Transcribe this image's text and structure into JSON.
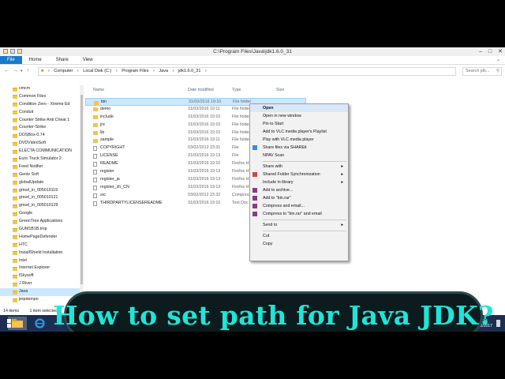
{
  "window": {
    "title": "C:\\Program Files\\Java\\jdk1.6.0_31",
    "controls": [
      "–",
      "□",
      "✕"
    ]
  },
  "ribbon": {
    "tabs": [
      "File",
      "Home",
      "Share",
      "View"
    ]
  },
  "nav": {
    "back": "←",
    "forward": "→",
    "up": "↑",
    "path": [
      "Computer",
      "Local Disk (C:)",
      "Program Files",
      "Java",
      "jdk1.6.0_31"
    ],
    "search_placeholder": "Search jdk..."
  },
  "sidebar": {
    "items": [
      "cmcm",
      "Common Files",
      "Condition Zero - Xtreme Ed",
      "Conduit",
      "Counter Strike Anti Cheat 1",
      "Counter-Strike",
      "DOSBox-0.74",
      "DVDVideoSoft",
      "ELECTA COMMUNICATION",
      "Euro Truck Simulator 2",
      "Feed Notifier",
      "Genie Soft",
      "globalUpdate",
      "gmsd_in_005010119",
      "gmsd_in_005010121",
      "gmsd_in_005010129",
      "Google",
      "GreenTree Applications",
      "GUM1B1B.tmp",
      "HomePageDefender",
      "HTC",
      "InstallShield Installation",
      "Intel",
      "Internet Explorer",
      "iSkysoft",
      "J River",
      "Java",
      "jeqotempo"
    ],
    "selected_index": 26
  },
  "columns": {
    "name": "Name",
    "date": "Date modified",
    "type": "Type",
    "size": "Size"
  },
  "files": [
    {
      "name": "bin",
      "date": "31/03/2016 19:10",
      "type": "File folder",
      "kind": "folder"
    },
    {
      "name": "demo",
      "date": "31/03/2016 19:11",
      "type": "File folder",
      "kind": "folder"
    },
    {
      "name": "include",
      "date": "31/03/2016 19:10",
      "type": "File folder",
      "kind": "folder"
    },
    {
      "name": "jre",
      "date": "31/03/2016 19:10",
      "type": "File folder",
      "kind": "folder"
    },
    {
      "name": "lib",
      "date": "31/03/2016 19:10",
      "type": "File folder",
      "kind": "folder"
    },
    {
      "name": "sample",
      "date": "31/03/2016 19:11",
      "type": "File folder",
      "kind": "folder"
    },
    {
      "name": "COPYRIGHT",
      "date": "03/02/2012 23:31",
      "type": "File",
      "kind": "doc"
    },
    {
      "name": "LICENSE",
      "date": "31/03/2016 19:13",
      "type": "File",
      "kind": "doc"
    },
    {
      "name": "README",
      "date": "31/03/2016 19:10",
      "type": "Firefox HTML",
      "kind": "doc"
    },
    {
      "name": "register",
      "date": "31/03/2016 19:13",
      "type": "Firefox HTML",
      "kind": "doc"
    },
    {
      "name": "register_ja",
      "date": "31/03/2016 19:13",
      "type": "Firefox HTML",
      "kind": "doc"
    },
    {
      "name": "register_zh_CN",
      "date": "31/03/2016 19:13",
      "type": "Firefox HTML",
      "kind": "doc"
    },
    {
      "name": "src",
      "date": "03/02/2012 23:32",
      "type": "Compressed",
      "kind": "doc"
    },
    {
      "name": "THIRDPARTYLICENSEREADME",
      "date": "31/03/2016 19:10",
      "type": "Text Doc",
      "kind": "doc"
    }
  ],
  "context_menu": [
    {
      "label": "Open",
      "bold": true
    },
    {
      "label": "Open in new window"
    },
    {
      "label": "Pin to Start"
    },
    {
      "label": "Add to VLC media player's Playlist"
    },
    {
      "label": "Play with VLC media player"
    },
    {
      "label": "Share files via SHAREit",
      "icon": "shareit-icon"
    },
    {
      "label": "NPAV Scan"
    },
    {
      "sep": true
    },
    {
      "label": "Share with",
      "sub": true
    },
    {
      "label": "Shared Folder Synchronization",
      "sub": true,
      "icon": "sync-icon"
    },
    {
      "label": "Include in library",
      "sub": true
    },
    {
      "label": "Add to archive...",
      "icon": "winrar-icon"
    },
    {
      "label": "Add to \"bin.rar\"",
      "icon": "winrar-icon"
    },
    {
      "label": "Compress and email...",
      "icon": "winrar-icon"
    },
    {
      "label": "Compress to \"bin.rar\" and email",
      "icon": "winrar-icon"
    },
    {
      "sep": true
    },
    {
      "label": "Send to",
      "sub": true
    },
    {
      "sep": true
    },
    {
      "label": "Cut"
    },
    {
      "label": "Copy"
    }
  ],
  "status": {
    "items": "14 items",
    "selected": "1 item selected"
  },
  "taskbar": {
    "apps": [
      "start-icon",
      "file-explorer-icon",
      "internet-explorer-icon",
      "chrome-icon",
      "shareit-icon",
      "firefox-icon"
    ],
    "time": "03:34",
    "date": "28/02/2017"
  },
  "banner": {
    "text": "How to set path for Java JDK?"
  },
  "colors": {
    "banner_text": "#1ee5d8",
    "file_tab": "#1979ca",
    "selection": "#cce8ff",
    "taskbar": "#1c2f52"
  }
}
